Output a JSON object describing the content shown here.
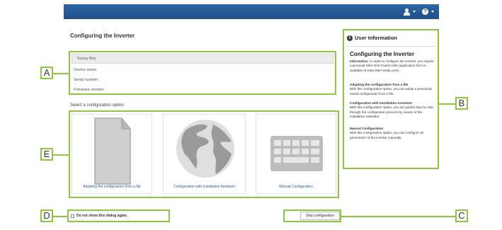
{
  "page": {
    "title": "Configuring the Inverter"
  },
  "device_panel": {
    "header": "Sunny Boy",
    "rows": [
      "Device name:",
      "Serial number:",
      "Firmware version:"
    ]
  },
  "config": {
    "select_label": "Select a configuration option:",
    "options": [
      {
        "label": "Adopting the configuration from a file",
        "icon": "file-icon"
      },
      {
        "label": "Configuration with Installation Assistant",
        "icon": "globe-icon"
      },
      {
        "label": "Manual Configuration",
        "icon": "keyboard-icon"
      }
    ]
  },
  "user_info": {
    "header": "User Information",
    "title": "Configuring the Inverter",
    "information_label": "Information:",
    "information_text": "In order to configure the inverter, you require a personal SMA Grid Guard code (application form is available at www.SMA-Solar.com).",
    "sections": [
      {
        "title": "Adopting the configuration from a file",
        "text": "With this configuration option, you can adopt a previously saved configuration from a file."
      },
      {
        "title": "Configuration with Installation Assistant",
        "text": "With this configuration option, you are guided step by step through the configuration process by means of the installation assistant."
      },
      {
        "title": "Manual Configuration",
        "text": "With this configuration option, you can configure all parameters of the inverter manually."
      }
    ]
  },
  "footer": {
    "dont_show_label": "Do not show this dialog again.",
    "skip_label": "Skip configuration"
  },
  "callouts": {
    "a": "A",
    "b": "B",
    "c": "C",
    "d": "D",
    "e": "E"
  },
  "colors": {
    "accent": "#8dc63f",
    "topbar": "#1f4f8a",
    "link": "#2a5a9c"
  }
}
